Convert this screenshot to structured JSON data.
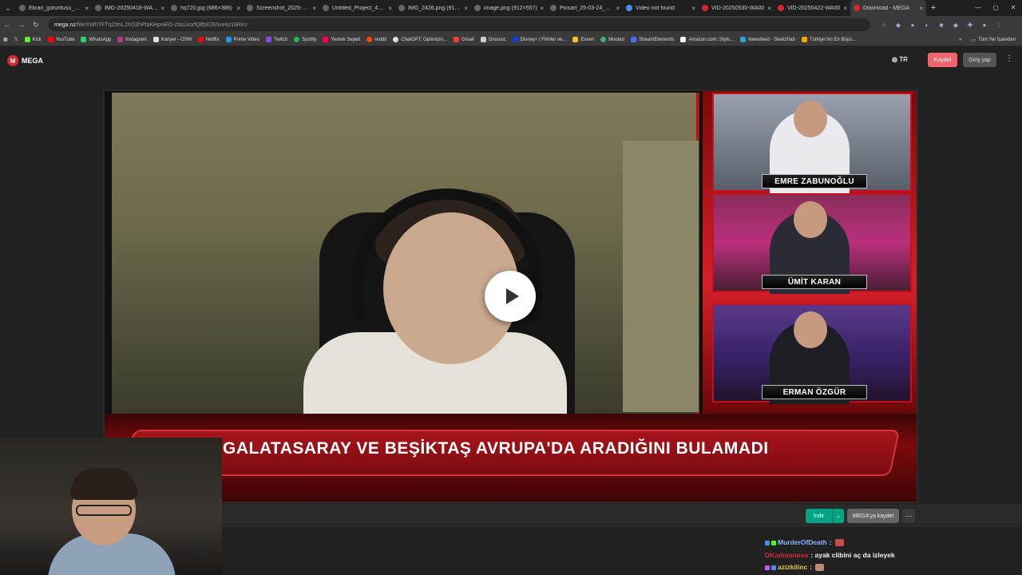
{
  "browser": {
    "tabs": [
      {
        "label": "Ekran_goruntusu_2025",
        "active": false
      },
      {
        "label": "IMG-20250418-WA00",
        "active": false
      },
      {
        "label": "hq720.jpg (686×386)",
        "active": false
      },
      {
        "label": "Screenshot_2025-04-2",
        "active": false
      },
      {
        "label": "Untitled_Project_4.jpg",
        "active": false
      },
      {
        "label": "IMG_2426.png (912×4",
        "active": false
      },
      {
        "label": "image.png (912×557)",
        "active": false
      },
      {
        "label": "Picsart_25-03-24_00-4",
        "active": false
      },
      {
        "label": "Video not found",
        "active": false
      },
      {
        "label": "VID-20250530-WA00",
        "active": false
      },
      {
        "label": "VID-20250422-WA00",
        "active": false
      },
      {
        "label": "Download - MEGA",
        "active": true
      }
    ],
    "url_host": "mega.nz",
    "url_path": "/file/XWhTFTqZ#nLJXO3hPtaKHpwEO-zbsLkorfQltbE265xe8z19RKc",
    "bookmarks": [
      "Kick",
      "YouTube",
      "WhatsApp",
      "Instagram",
      "Kariyer - OSM",
      "Netflix",
      "Prime Video",
      "Twitch",
      "Spotify",
      "Yemek Sepeti",
      "reddit",
      "ChatGPT: Optimizin...",
      "Gmail",
      "Gnoosic",
      "Disney+ | Filmler ve...",
      "Exxen",
      "Moobot",
      "StreamElements",
      "Amazon.com: Stylo...",
      "Newsfeed - Sketchfab",
      "Türkiye'nin En Büyü..."
    ],
    "bookmarks_all": "Tüm Yer İşaretleri"
  },
  "mega": {
    "logo_text": "MEGA",
    "lang": "TR",
    "signup": "Kaydol",
    "login": "Giriş yap",
    "download": "İndir",
    "save_to_mega": "MEGA'ya kaydet"
  },
  "video": {
    "headline": "GALATASARAY VE BEŞİKTAŞ AVRUPA'DA ARADIĞINI BULAMADI",
    "names": [
      "EMRE ZABUNOĞLU",
      "ÜMİT KARAN",
      "ERMAN ÖZGÜR"
    ]
  },
  "chat": [
    {
      "user": "MurderOfDeath",
      "message": "",
      "color": "#8ab4ff"
    },
    {
      "user": "DKadmanovs",
      "message": "ayak clibini aç da izleyek",
      "color": "#d9273b"
    },
    {
      "user": "azizkilinc",
      "message": "",
      "color": "#e3c73a"
    }
  ]
}
